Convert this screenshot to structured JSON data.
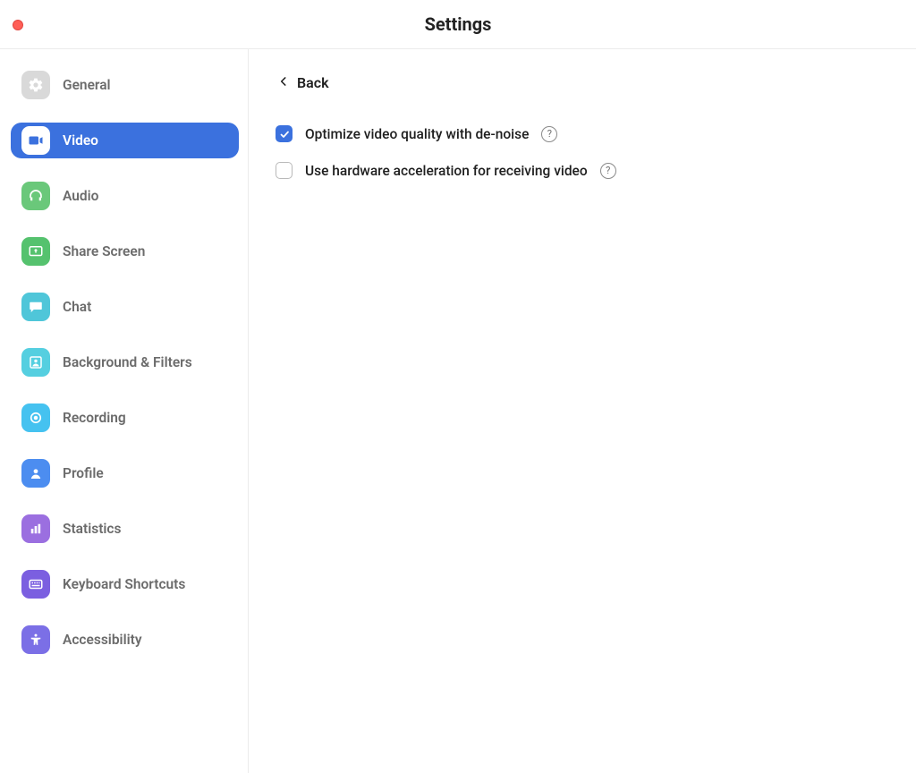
{
  "title": "Settings",
  "sidebar": {
    "items": [
      {
        "label": "General"
      },
      {
        "label": "Video"
      },
      {
        "label": "Audio"
      },
      {
        "label": "Share Screen"
      },
      {
        "label": "Chat"
      },
      {
        "label": "Background & Filters"
      },
      {
        "label": "Recording"
      },
      {
        "label": "Profile"
      },
      {
        "label": "Statistics"
      },
      {
        "label": "Keyboard Shortcuts"
      },
      {
        "label": "Accessibility"
      }
    ]
  },
  "content": {
    "back_label": "Back",
    "options": [
      {
        "label": "Optimize video quality with de-noise",
        "checked": true
      },
      {
        "label": "Use hardware acceleration for receiving video",
        "checked": false
      }
    ]
  }
}
